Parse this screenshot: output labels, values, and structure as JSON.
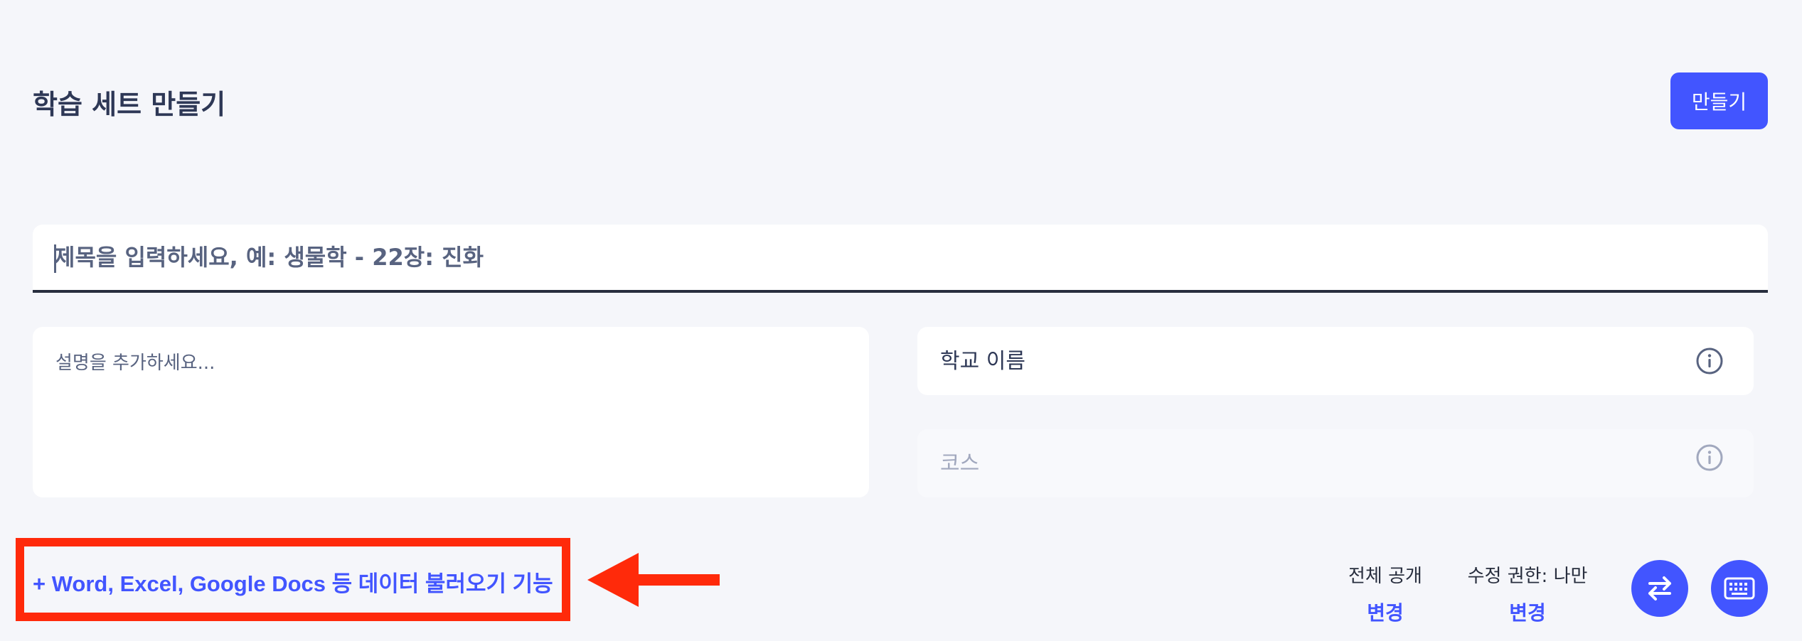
{
  "header": {
    "title": "학습 세트 만들기",
    "create_label": "만들기"
  },
  "title_field": {
    "placeholder": "제목을 입력하세요, 예: 생물학 - 22장: 진화"
  },
  "description_field": {
    "placeholder": "설명을 추가하세요..."
  },
  "school_field": {
    "placeholder": "학교 이름",
    "icon": "info-icon"
  },
  "course_field": {
    "placeholder": "코스",
    "icon": "info-icon"
  },
  "import": {
    "label": "+ Word, Excel, Google Docs 등 데이터 불러오기 기능",
    "highlight_color": "#ff2a0a"
  },
  "settings": {
    "visibility": {
      "label": "전체 공개",
      "change": "변경"
    },
    "permission": {
      "label": "수정 권한: 나만",
      "change": "변경"
    }
  },
  "actions": {
    "swap_icon": "swap-arrows-icon",
    "keyboard_icon": "keyboard-icon"
  },
  "colors": {
    "accent": "#4255ff",
    "background": "#f5f6fa",
    "annotation": "#ff2a0a"
  }
}
